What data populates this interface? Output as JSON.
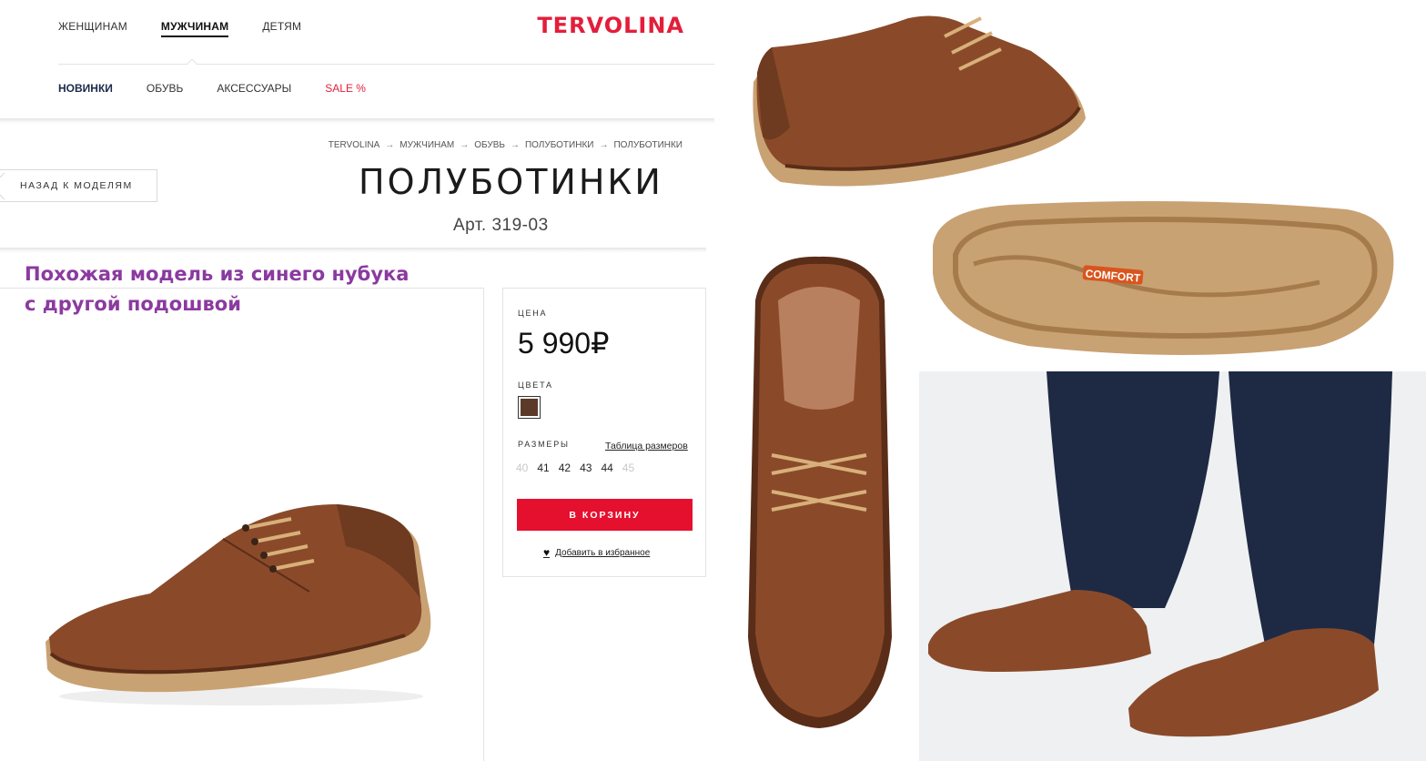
{
  "nav": {
    "top": [
      "ЖЕНЩИНАМ",
      "МУЖЧИНАМ",
      "ДЕТЯМ"
    ],
    "active": "МУЖЧИНАМ",
    "logo": "TERVOLINA",
    "sub": [
      "НОВИНКИ",
      "ОБУВЬ",
      "АКСЕССУАРЫ",
      "SALE %"
    ]
  },
  "breadcrumbs": [
    "TERVOLINA",
    "МУЖЧИНАМ",
    "ОБУВЬ",
    "ПОЛУБОТИНКИ",
    "ПОЛУБОТИНКИ"
  ],
  "back_label": "НАЗАД К МОДЕЛЯМ",
  "product": {
    "title": "ПОЛУБОТИНКИ",
    "article": "Арт. 319-03"
  },
  "overlay_text": {
    "line1": "Похожая модель из синего нубука",
    "line2": "с другой подошвой"
  },
  "buybox": {
    "price_label": "ЦЕНА",
    "price": "5 990₽",
    "colors_label": "ЦВЕТА",
    "swatch_color": "#5b3a2a",
    "sizes_label": "РАЗМЕРЫ",
    "size_table_link": "Таблица размеров",
    "sizes": [
      {
        "size": "40",
        "available": false
      },
      {
        "size": "41",
        "available": true
      },
      {
        "size": "42",
        "available": true
      },
      {
        "size": "43",
        "available": true
      },
      {
        "size": "44",
        "available": true
      },
      {
        "size": "45",
        "available": false
      }
    ],
    "cart_button": "В КОРЗИНУ",
    "favorite_link": "Добавить в избранное"
  },
  "sole_badge": "COMFORT",
  "colors": {
    "brand_red": "#e31e3a",
    "leather": "#8a4a2a",
    "sole": "#c9a273",
    "overlay_purple": "#8b3aa0"
  }
}
